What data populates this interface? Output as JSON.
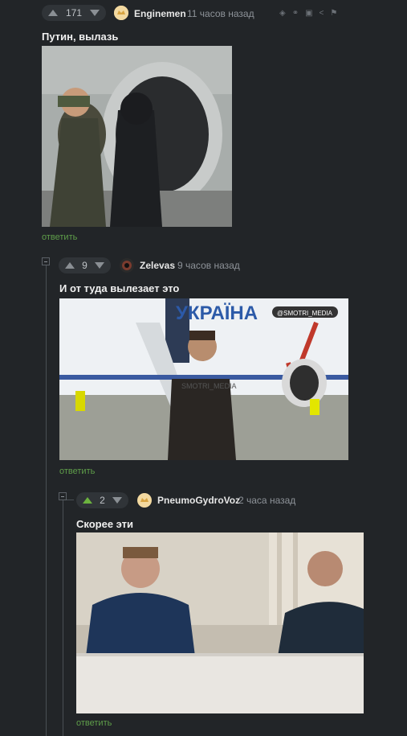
{
  "comments": [
    {
      "votes": "171",
      "username": "Enginemen",
      "time": "11 часов назад",
      "text": "Путин, вылазь",
      "reply_label": "ответить",
      "action_icons": [
        "rss-icon",
        "link-icon",
        "save-icon",
        "share-icon",
        "flag-icon"
      ]
    },
    {
      "votes": "9",
      "username": "Zelevas",
      "time": "9 часов назад",
      "text": "И от туда вылезает это",
      "reply_label": "ответить",
      "image": {
        "sign": "УКРАЇНА",
        "watermark": "@SMOTRI_MEDIA",
        "logo": "SMOTRI_MEDIA"
      }
    },
    {
      "votes": "2",
      "username": "PneumoGydroVoz",
      "time": "2 часа назад",
      "text": "Скорее эти",
      "reply_label": "ответить"
    }
  ],
  "colors": {
    "background": "#222528",
    "reply": "#5f9e4a",
    "vote_up_active": "#6cb33f"
  }
}
